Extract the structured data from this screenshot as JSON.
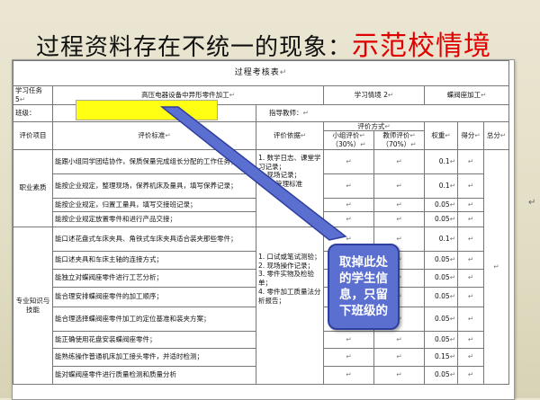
{
  "heading": {
    "main": "过程资料存在不统一的现象：",
    "emphasis": "示范校情境"
  },
  "form": {
    "title": "过程考核表",
    "task_label": "学习任务 5",
    "task_name": "高压电器设备中异形零件加工",
    "situation_label": "学习情境 2",
    "situation_name": "蝶阀座加工",
    "class_label": "班级：",
    "teacher_label": "指导教师：",
    "headers": {
      "item": "评价项目",
      "standard": "评价标准",
      "basis": "评价依据",
      "method": "评价方式",
      "group": "小组评价",
      "group_pct": "（30%）",
      "teacher": "教师评价",
      "teacher_pct": "（70%）",
      "weight": "权重",
      "score": "得分",
      "total": "总分"
    },
    "sections": [
      {
        "name": "职业素质",
        "basis": "1. 数学日志、课堂学习记录；\n3. 现场记录；\n4. 6S管理标准",
        "rows": [
          {
            "std": "能跟小组同学团结协作，保质保量完成组长分配的工作任务；",
            "weight": "0.1"
          },
          {
            "std": "能按企业规定，整理现场，保养机床及量具，填写保养记录；",
            "weight": "0.1"
          },
          {
            "std": "能按企业规定，归置工量具，填写交接班记录；",
            "weight": "0.05"
          },
          {
            "std": "能按企业规定放置零件和进行产品交接；",
            "weight": "0.05"
          }
        ]
      },
      {
        "name": "专业知识与技能",
        "basis": "1. 口试或笔试测验；\n2. 现场操作记录；\n3. 零件实物及检验单；\n4. 零件加工质量法分析报告；",
        "rows": [
          {
            "std": "能口述花盘式车床夹具、角铁式车床夹具适合装夹那些零件；",
            "weight": "0.1"
          },
          {
            "std": "能口述夹具和车床主轴的连接方式；",
            "weight": "0.05"
          },
          {
            "std": "能独立对蝶阀座零件进行工艺分析；",
            "weight": "0.05"
          },
          {
            "std": "能合理安排蝶阀座零件的加工顺序；",
            "weight": "0.05"
          },
          {
            "std": "能合理选择蝶阀座零件加工的定位基准和装夹方案；",
            "weight": "0.05"
          },
          {
            "std": "能正确使用花盘安装蝶阀座零件；",
            "weight": "0.05"
          },
          {
            "std": "能熟练操作普通机床加工接头零件，并适时检测；",
            "weight": "0.15"
          },
          {
            "std": "能对蝶阀座零件进行质量检测和质量分析",
            "weight": "0.05"
          }
        ]
      }
    ]
  },
  "callout": {
    "text": "取掉此处的学生信息，只留下班级的"
  }
}
